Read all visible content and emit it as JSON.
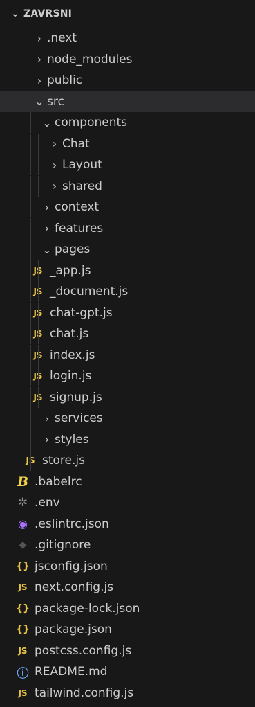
{
  "explorer": {
    "title": "ZAVRSNI",
    "icons": {
      "folder_closed": "›",
      "folder_open": "⌄",
      "js": "JS",
      "babel": "B",
      "env": "✲",
      "eslint": "◉",
      "git": "◆",
      "json": "{}",
      "info": "ⓘ"
    },
    "colors": {
      "background": "#181818",
      "selected_row": "#2c2c2e",
      "js": "#e8c547",
      "eslint": "#a970ff",
      "info": "#6aaaf5"
    }
  },
  "tree": [
    {
      "label": ".next",
      "type": "folder",
      "expanded": false,
      "depth": 1,
      "icon": "folder-closed"
    },
    {
      "label": "node_modules",
      "type": "folder",
      "expanded": false,
      "depth": 1,
      "icon": "folder-closed"
    },
    {
      "label": "public",
      "type": "folder",
      "expanded": false,
      "depth": 1,
      "icon": "folder-closed"
    },
    {
      "label": "src",
      "type": "folder",
      "expanded": true,
      "depth": 1,
      "icon": "folder-open",
      "selected": true
    },
    {
      "label": "components",
      "type": "folder",
      "expanded": true,
      "depth": 2,
      "icon": "folder-open"
    },
    {
      "label": "Chat",
      "type": "folder",
      "expanded": false,
      "depth": 3,
      "icon": "folder-closed"
    },
    {
      "label": "Layout",
      "type": "folder",
      "expanded": false,
      "depth": 3,
      "icon": "folder-closed"
    },
    {
      "label": "shared",
      "type": "folder",
      "expanded": false,
      "depth": 3,
      "icon": "folder-closed"
    },
    {
      "label": "context",
      "type": "folder",
      "expanded": false,
      "depth": 2,
      "icon": "folder-closed"
    },
    {
      "label": "features",
      "type": "folder",
      "expanded": false,
      "depth": 2,
      "icon": "folder-closed"
    },
    {
      "label": "pages",
      "type": "folder",
      "expanded": true,
      "depth": 2,
      "icon": "folder-open"
    },
    {
      "label": "_app.js",
      "type": "file",
      "depth": 3,
      "icon": "js"
    },
    {
      "label": "_document.js",
      "type": "file",
      "depth": 3,
      "icon": "js"
    },
    {
      "label": "chat-gpt.js",
      "type": "file",
      "depth": 3,
      "icon": "js"
    },
    {
      "label": "chat.js",
      "type": "file",
      "depth": 3,
      "icon": "js"
    },
    {
      "label": "index.js",
      "type": "file",
      "depth": 3,
      "icon": "js"
    },
    {
      "label": "login.js",
      "type": "file",
      "depth": 3,
      "icon": "js"
    },
    {
      "label": "signup.js",
      "type": "file",
      "depth": 3,
      "icon": "js"
    },
    {
      "label": "services",
      "type": "folder",
      "expanded": false,
      "depth": 2,
      "icon": "folder-closed"
    },
    {
      "label": "styles",
      "type": "folder",
      "expanded": false,
      "depth": 2,
      "icon": "folder-closed"
    },
    {
      "label": "store.js",
      "type": "file",
      "depth": 2,
      "icon": "js"
    },
    {
      "label": ".babelrc",
      "type": "file",
      "depth": 1,
      "icon": "babel"
    },
    {
      "label": ".env",
      "type": "file",
      "depth": 1,
      "icon": "env"
    },
    {
      "label": ".eslintrc.json",
      "type": "file",
      "depth": 1,
      "icon": "eslint"
    },
    {
      "label": ".gitignore",
      "type": "file",
      "depth": 1,
      "icon": "git"
    },
    {
      "label": "jsconfig.json",
      "type": "file",
      "depth": 1,
      "icon": "json"
    },
    {
      "label": "next.config.js",
      "type": "file",
      "depth": 1,
      "icon": "js"
    },
    {
      "label": "package-lock.json",
      "type": "file",
      "depth": 1,
      "icon": "json"
    },
    {
      "label": "package.json",
      "type": "file",
      "depth": 1,
      "icon": "json"
    },
    {
      "label": "postcss.config.js",
      "type": "file",
      "depth": 1,
      "icon": "js"
    },
    {
      "label": "README.md",
      "type": "file",
      "depth": 1,
      "icon": "info"
    },
    {
      "label": "tailwind.config.js",
      "type": "file",
      "depth": 1,
      "icon": "js"
    }
  ]
}
